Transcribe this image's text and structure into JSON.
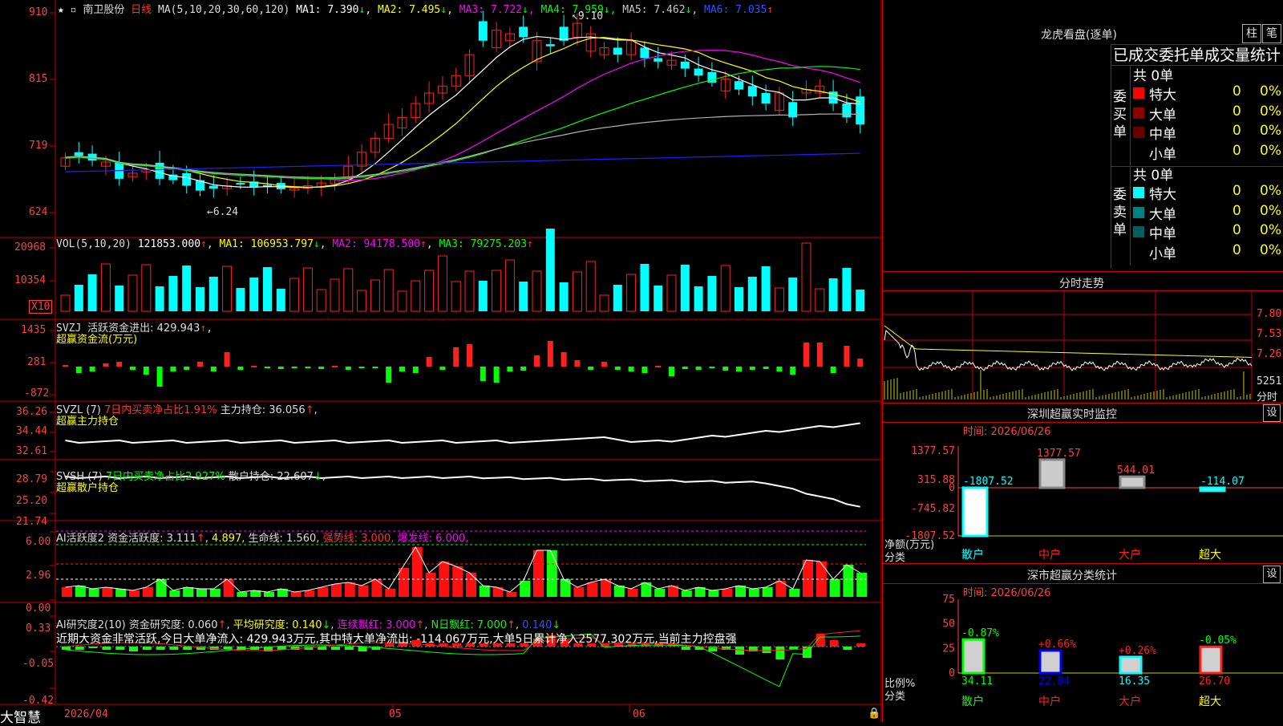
{
  "colors": {
    "up": "#ff2020",
    "down": "#00ffff",
    "bg": "#000000",
    "grid": "#c00000",
    "ma1": "#ffffff",
    "ma2": "#ffff00",
    "ma3": "#ff00ff",
    "ma4": "#00ff00",
    "ma5": "#b0b0b0",
    "ma6": "#2020ff",
    "green": "#00ff00",
    "yellow": "#ffff00",
    "magenta": "#ff00ff",
    "axis": "#ff4040"
  },
  "app_name": "大智慧",
  "stock": {
    "name": "南卫股份",
    "period": "日线"
  },
  "price_panel": {
    "ma_header": "MA(5,10,20,30,60,120)",
    "mas": [
      {
        "label": "MA1:",
        "value": "7.390",
        "arrow": "↓"
      },
      {
        "label": "MA2:",
        "value": "7.495",
        "arrow": "↓"
      },
      {
        "label": "MA3:",
        "value": "7.722",
        "arrow": "↓"
      },
      {
        "label": "MA4:",
        "value": "7.959",
        "arrow": "↓"
      },
      {
        "label": "MA5:",
        "value": "7.462",
        "arrow": "↓"
      },
      {
        "label": "MA6:",
        "value": "7.035",
        "arrow": "↑"
      }
    ],
    "y_ticks": [
      "910",
      "815",
      "719",
      "624"
    ],
    "high_label": "9.10",
    "low_label": "6.24"
  },
  "vol_panel": {
    "header": "VOL(5,10,20)",
    "value": "121853.000",
    "ma1": "MA1: 106953.797",
    "ma2": "MA2: 94178.500",
    "ma3": "MA3: 79275.203",
    "y_ticks": [
      "20968",
      "10354"
    ],
    "unit": "X10"
  },
  "svzj_panel": {
    "header": "SVZJ",
    "label": "活跃资金进出: 429.943",
    "subtitle": "超赢资金流(万元)",
    "y_ticks": [
      "1435",
      "281",
      "-872"
    ]
  },
  "svzl_panel": {
    "header": "SVZL (7)",
    "ratio": "7日内买卖净占比1.91%",
    "main": "主力持仓: 36.056",
    "subtitle": "超赢主力持仓",
    "y_ticks": [
      "36.26",
      "34.44",
      "32.61"
    ]
  },
  "svsh_panel": {
    "header": "SVSH (7)",
    "ratio": "7日内买卖净占比2.927%",
    "retail": "散户持仓: 22.607",
    "subtitle": "超赢散户持仓",
    "y_ticks": [
      "28.79",
      "25.20",
      "21.74"
    ]
  },
  "ai_panel": {
    "header": "AI活跃度2",
    "active": "资金活跃度: 3.111",
    "v2": "4.897,",
    "life": "生命线: 1.560,",
    "strong": "强势线: 3.000,",
    "burst": "爆发线: 6.000,",
    "y_ticks": [
      "6.00",
      "2.96",
      "0.00"
    ]
  },
  "ai2_panel": {
    "header": "AI研究度2(10)",
    "res": "资金研究度: 0.060",
    "avg": "平均研究度: 0.140",
    "cont": "连续飘红: 3.000",
    "nday": "N日飘红: 7.000",
    "last": "0.140",
    "note": "近期大资金非常活跃,今日大单净流入: 429.943万元,其中特大单净流出: -114.067万元,大单5日累计净入2577.302万元,当前主力控盘强",
    "y_ticks": [
      "0.33",
      "-0.05",
      "-0.42"
    ]
  },
  "x_axis": {
    "labels": [
      "2026/04",
      "05",
      "06"
    ]
  },
  "dragon": {
    "title": "龙虎看盘(逐单)",
    "btn1": "柱",
    "btn2": "笔",
    "subtitle": "已成交委托单成交量统计",
    "buy": {
      "side_label": "委买单",
      "total": "共 0单",
      "rows": [
        {
          "name": "特大",
          "v": "0",
          "p": "0%"
        },
        {
          "name": "大单",
          "v": "0",
          "p": "0%"
        },
        {
          "name": "中单",
          "v": "0",
          "p": "0%"
        },
        {
          "name": "小单",
          "v": "0",
          "p": "0%"
        }
      ]
    },
    "sell": {
      "side_label": "委卖单",
      "total": "共 0单",
      "rows": [
        {
          "name": "特大",
          "v": "0",
          "p": "0%"
        },
        {
          "name": "大单",
          "v": "0",
          "p": "0%"
        },
        {
          "name": "中单",
          "v": "0",
          "p": "0%"
        },
        {
          "name": "小单",
          "v": "0",
          "p": "0%"
        }
      ]
    }
  },
  "intraday": {
    "title": "分时走势",
    "y_ticks": [
      "7.80",
      "7.53",
      "7.26"
    ],
    "vol_label": "5251",
    "vol_unit": "分时"
  },
  "monitor": {
    "title": "深圳超赢实时监控",
    "btn": "设",
    "time": "时间: 2026/06/26",
    "y_ticks": [
      "1377.57",
      "315.88",
      "0",
      "-745.82",
      "-1807.52"
    ],
    "y_caption": "净额(万元)",
    "x_caption": "分类",
    "bars": [
      {
        "cat": "散户",
        "value": -1807.52,
        "label": "-1807.52"
      },
      {
        "cat": "中户",
        "value": 1377.57,
        "label": "1377.57"
      },
      {
        "cat": "大户",
        "value": 544.01,
        "label": "544.01"
      },
      {
        "cat": "超大",
        "value": -114.07,
        "label": "-114.07"
      }
    ]
  },
  "class_stats": {
    "title": "深市超赢分类统计",
    "btn": "设",
    "time": "时间: 2026/06/26",
    "y_ticks": [
      "75",
      "50",
      "25",
      "0"
    ],
    "y_caption": "比例%",
    "x_caption": "分类",
    "bars": [
      {
        "cat": "散户",
        "value": 34.11,
        "label": "34.11",
        "chg": "-0.87%"
      },
      {
        "cat": "中户",
        "value": 22.84,
        "label": "22.84",
        "chg": "+0.66%"
      },
      {
        "cat": "大户",
        "value": 16.35,
        "label": "16.35",
        "chg": "+0.26%"
      },
      {
        "cat": "超大",
        "value": 26.7,
        "label": "26.70",
        "chg": "-0.05%"
      }
    ]
  }
}
